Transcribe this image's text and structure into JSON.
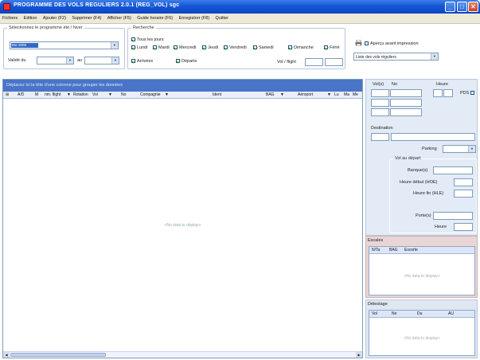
{
  "window": {
    "title": "PROGRAMME DES VOLS REGULIERS 2.0.1   (REG_VOL)   sgc",
    "minimize": "_",
    "maximize": "□",
    "close": "✕"
  },
  "menu": [
    "Fichiers",
    "Edition",
    "Ajouter (F2)",
    "Supprimer (F4)",
    "Afficher (F5)",
    "Guide horaire (F6)",
    "Enregistrer (F8)",
    "Quitter"
  ],
  "filters": {
    "program_group_label": "Sélectionnez le programme été / hiver",
    "program_selected": "Ete 2008",
    "valid_from_label": "Validé du",
    "valid_to_label": "au",
    "search_group_label": "Recherche",
    "all_days_label": "Tous les jours",
    "days": [
      "Lundi",
      "Mardi",
      "Mercredi",
      "Jeudi",
      "Vendredi",
      "Samedi",
      "Dimanche",
      "Férié"
    ],
    "arrivals_label": "Arrivées",
    "departures_label": "Départs",
    "flight_label": "Vol / flight",
    "print_preview_label": "Aperçu avant impression",
    "report_selected": "Liste des vols réguliers",
    "printer_icon": "printer-icon"
  },
  "grid": {
    "group_hint": "Déplacez ici la tête d'une colonne pour grouper les données",
    "columns": [
      "A/D",
      "M",
      "nm. flight",
      "Rotation",
      "Vol",
      "No",
      "Compagnie",
      "Ident",
      "BAG",
      "Aéroport",
      "Lu",
      "Ma",
      "Me"
    ],
    "no_data": "<No data to display>"
  },
  "details": {
    "vol_label": "Vol(s)",
    "no_label": "No",
    "heure_label": "Heure",
    "pds_label": "PDS",
    "destination_label": "Destination",
    "parking_label": "Parking",
    "vol_depart_label": "Vol au départ",
    "banque_label": "Banque(s)",
    "heure_debut_label": "Heure début (HOE)",
    "heure_fin_label": "Heure fin (HLE)",
    "portes_label": "Porte(s)",
    "heure_label2": "Heure"
  },
  "escales": {
    "title": "Escales",
    "columns": [
      "N/Ta",
      "BAG",
      "Escorte"
    ],
    "no_data": "<No data to display>"
  },
  "delestage": {
    "title": "Délestage",
    "columns": [
      "Vol",
      "No",
      "Du",
      "AU"
    ],
    "no_data": "<No data to display>"
  }
}
